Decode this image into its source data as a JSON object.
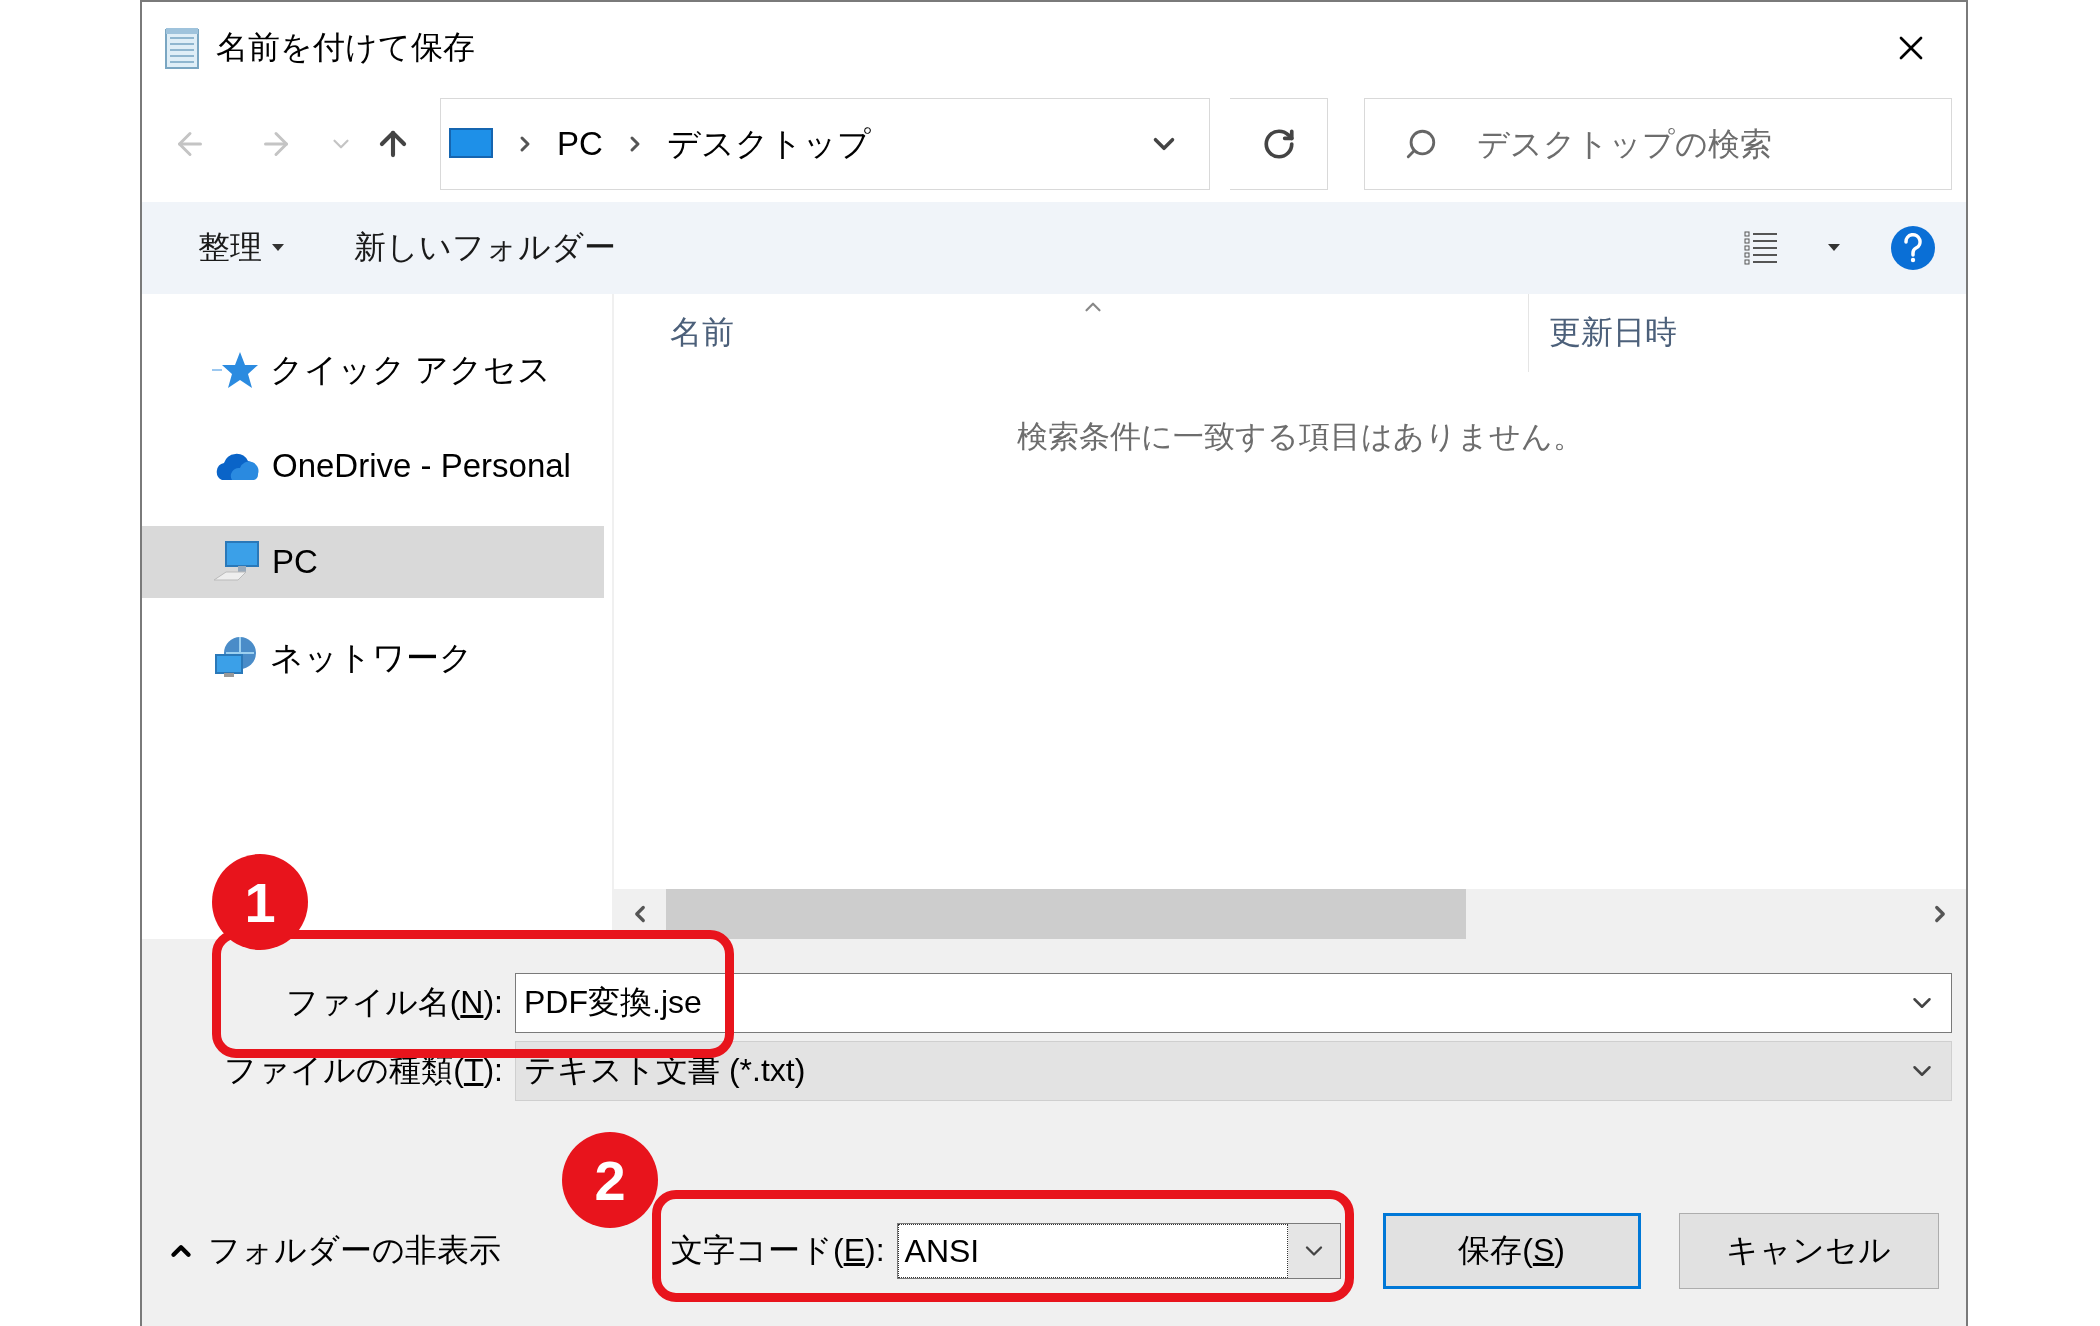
{
  "window": {
    "title": "名前を付けて保存"
  },
  "navigation": {
    "back_disabled": true,
    "forward_disabled": true,
    "breadcrumb": [
      "PC",
      "デスクトップ"
    ],
    "search": {
      "placeholder": "デスクトップの検索"
    }
  },
  "toolbar": {
    "organize": "整理",
    "new_folder": "新しいフォルダー"
  },
  "sidebar": {
    "items": [
      {
        "kind": "quick",
        "label": "クイック アクセス",
        "selected": false
      },
      {
        "kind": "cloud",
        "label": "OneDrive - Personal",
        "selected": false
      },
      {
        "kind": "pc",
        "label": "PC",
        "selected": true
      },
      {
        "kind": "network",
        "label": "ネットワーク",
        "selected": false
      }
    ]
  },
  "file_list": {
    "columns": [
      "名前",
      "更新日時"
    ],
    "empty_message": "検索条件に一致する項目はありません。"
  },
  "form": {
    "file_name": {
      "label_before": "ファイル名(",
      "access_key": "N",
      "label_after": "):",
      "value": "PDF変換.jse"
    },
    "file_type": {
      "label_before": "ファイルの種類(",
      "access_key": "T",
      "label_after": "):",
      "value": "テキスト文書 (*.txt)"
    },
    "encoding": {
      "label_before": "文字コード(",
      "access_key": "E",
      "label_after": "):",
      "value": "ANSI"
    }
  },
  "footer": {
    "hide_folders": "フォルダーの非表示",
    "save": {
      "before": "保存(",
      "access_key": "S",
      "after": ")"
    },
    "cancel": "キャンセル"
  },
  "annotations": [
    {
      "number": "1"
    },
    {
      "number": "2"
    }
  ]
}
